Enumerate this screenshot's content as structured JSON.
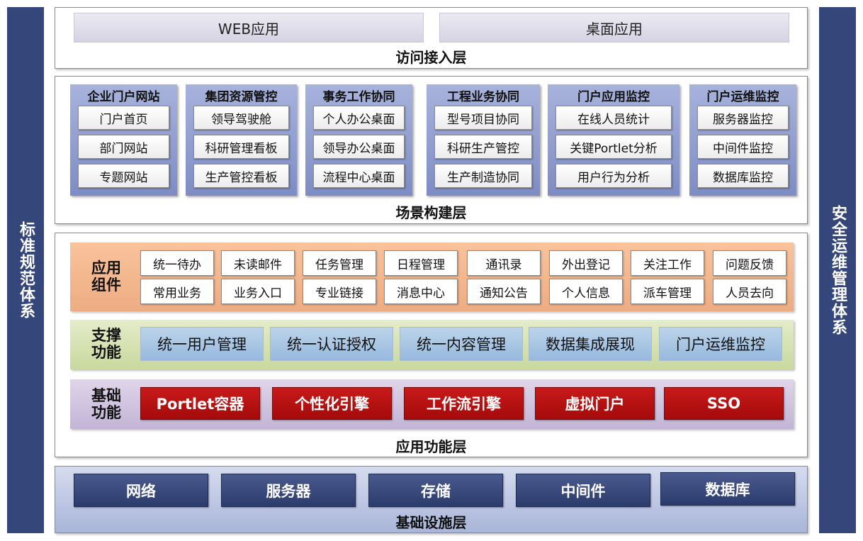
{
  "left_sidebar": "标准规范体系",
  "right_sidebar": "安全运维管理体系",
  "access_layer": {
    "title": "访问接入层",
    "tabs": [
      "WEB应用",
      "桌面应用"
    ]
  },
  "scene_layer": {
    "title": "场景构建层",
    "groups": [
      {
        "title": "企业门户网站",
        "items": [
          "门户首页",
          "部门网站",
          "专题网站"
        ]
      },
      {
        "title": "集团资源管控",
        "items": [
          "领导驾驶舱",
          "科研管理看板",
          "生产管控看板"
        ]
      },
      {
        "title": "事务工作协同",
        "items": [
          "个人办公桌面",
          "领导办公桌面",
          "流程中心桌面"
        ]
      },
      {
        "title": "工程业务协同",
        "items": [
          "型号项目协同",
          "科研生产管控",
          "生产制造协同"
        ]
      },
      {
        "title": "门户应用监控",
        "items": [
          "在线人员统计",
          "关键Portlet分析",
          "用户行为分析"
        ]
      },
      {
        "title": "门户运维监控",
        "items": [
          "服务器监控",
          "中间件监控",
          "数据库监控"
        ]
      }
    ]
  },
  "function_layer": {
    "title": "应用功能层",
    "components": {
      "label_line1": "应用",
      "label_line2": "组件",
      "row1": [
        "统一待办",
        "未读邮件",
        "任务管理",
        "日程管理",
        "通讯录",
        "外出登记",
        "关注工作",
        "问题反馈"
      ],
      "row2": [
        "常用业务",
        "业务入口",
        "专业链接",
        "消息中心",
        "通知公告",
        "个人信息",
        "派车管理",
        "人员去向"
      ]
    },
    "support": {
      "label_line1": "支撑",
      "label_line2": "功能",
      "items": [
        "统一用户管理",
        "统一认证授权",
        "统一内容管理",
        "数据集成展现",
        "门户运维监控"
      ]
    },
    "basic": {
      "label_line1": "基础",
      "label_line2": "功能",
      "items": [
        "Portlet容器",
        "个性化引擎",
        "工作流引擎",
        "虚拟门户",
        "SSO"
      ]
    }
  },
  "infra_layer": {
    "title": "基础设施层",
    "items": [
      "网络",
      "服务器",
      "存储",
      "中间件",
      "数据库"
    ]
  }
}
